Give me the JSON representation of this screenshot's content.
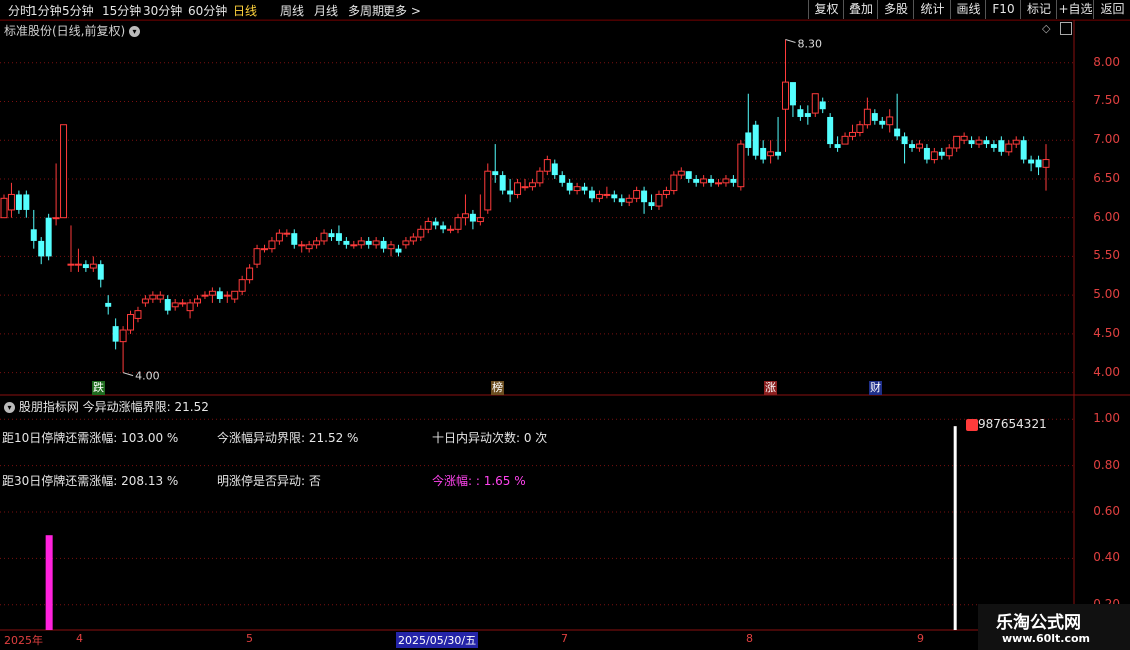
{
  "toolbar": {
    "periods": [
      "分时",
      "1分钟",
      "5分钟",
      "15分钟",
      "30分钟",
      "60分钟",
      "日线",
      "周线",
      "月线",
      "多周期",
      "更多 >"
    ],
    "active_period": "日线",
    "buttons": [
      "复权",
      "叠加",
      "多股",
      "统计",
      "画线",
      "F10",
      "标记",
      "+自选",
      "返回"
    ]
  },
  "main_chart": {
    "title": "标准股份(日线,前复权)",
    "y_labels": [
      "8.00",
      "7.50",
      "7.00",
      "6.50",
      "6.00",
      "5.50",
      "5.00",
      "4.50",
      "4.00"
    ],
    "high_label": "8.30",
    "low_label": "4.00",
    "event_tags": [
      "跌",
      "榜",
      "涨",
      "财"
    ]
  },
  "indicator": {
    "title": "股朋指标网",
    "threshold_label": "今异动涨幅界限: 21.52",
    "rows": [
      [
        "距10日停牌还需涨幅: 103.00 %",
        "今涨幅异动界限: 21.52 %",
        "十日内异动次数: 0 次"
      ],
      [
        "距30日停牌还需涨幅: 208.13 %",
        "明涨停是否异动: 否",
        "今涨幅: : 1.65 %"
      ]
    ],
    "y_labels": [
      "1.00",
      "0.80",
      "0.60",
      "0.40",
      "0.20"
    ],
    "marker_text": "987654321"
  },
  "date_axis": {
    "labels": [
      "2025年",
      "4",
      "5",
      "2025/05/30/五",
      "7",
      "8",
      "9"
    ]
  },
  "watermark": {
    "title": "乐淘公式网",
    "url": "www.60lt.com"
  },
  "colors": {
    "up": "#ff3b3b",
    "down": "#54ffff",
    "grid": "#7a1010",
    "magenta": "#ff22dd"
  },
  "chart_data": {
    "type": "candlestick",
    "y_range": [
      3.75,
      8.5
    ],
    "ohlc": [
      [
        6.0,
        6.25,
        6.05,
        6.3
      ],
      [
        6.1,
        6.3,
        6.0,
        6.45
      ],
      [
        6.3,
        6.1,
        6.05,
        6.35
      ],
      [
        6.3,
        6.1,
        6.0,
        6.35
      ],
      [
        5.85,
        5.7,
        5.6,
        6.1
      ],
      [
        5.7,
        5.5,
        5.4,
        5.75
      ],
      [
        6.0,
        5.5,
        5.45,
        6.05
      ],
      [
        6.0,
        6.0,
        5.9,
        6.7
      ],
      [
        6.0,
        7.2,
        6.0,
        7.2
      ],
      [
        5.4,
        5.4,
        5.3,
        5.9
      ],
      [
        5.4,
        5.4,
        5.3,
        5.6
      ],
      [
        5.4,
        5.35,
        5.3,
        5.45
      ],
      [
        5.35,
        5.4,
        5.3,
        5.5
      ],
      [
        5.4,
        5.2,
        5.1,
        5.45
      ],
      [
        4.9,
        4.85,
        4.75,
        5.0
      ],
      [
        4.6,
        4.4,
        4.3,
        4.7
      ],
      [
        4.4,
        4.55,
        4.0,
        4.6
      ],
      [
        4.55,
        4.75,
        4.5,
        4.8
      ],
      [
        4.7,
        4.8,
        4.65,
        4.85
      ],
      [
        4.9,
        4.95,
        4.85,
        5.0
      ],
      [
        4.95,
        5.0,
        4.9,
        5.05
      ],
      [
        4.95,
        5.0,
        4.9,
        5.05
      ],
      [
        4.95,
        4.8,
        4.75,
        5.0
      ],
      [
        4.85,
        4.9,
        4.8,
        4.95
      ],
      [
        4.9,
        4.9,
        4.85,
        4.95
      ],
      [
        4.8,
        4.9,
        4.7,
        4.95
      ],
      [
        4.9,
        4.95,
        4.85,
        5.0
      ],
      [
        5.0,
        5.0,
        4.95,
        5.05
      ],
      [
        5.0,
        5.05,
        4.9,
        5.1
      ],
      [
        5.05,
        4.95,
        4.9,
        5.1
      ],
      [
        5.0,
        5.0,
        4.9,
        5.05
      ],
      [
        4.95,
        5.05,
        4.9,
        5.05
      ],
      [
        5.05,
        5.2,
        5.0,
        5.25
      ],
      [
        5.2,
        5.35,
        5.15,
        5.4
      ],
      [
        5.4,
        5.6,
        5.35,
        5.65
      ],
      [
        5.6,
        5.6,
        5.55,
        5.65
      ],
      [
        5.6,
        5.7,
        5.55,
        5.75
      ],
      [
        5.7,
        5.8,
        5.65,
        5.85
      ],
      [
        5.8,
        5.8,
        5.75,
        5.85
      ],
      [
        5.8,
        5.65,
        5.6,
        5.85
      ],
      [
        5.65,
        5.65,
        5.55,
        5.7
      ],
      [
        5.6,
        5.65,
        5.55,
        5.7
      ],
      [
        5.65,
        5.7,
        5.6,
        5.75
      ],
      [
        5.7,
        5.8,
        5.65,
        5.85
      ],
      [
        5.8,
        5.75,
        5.7,
        5.85
      ],
      [
        5.8,
        5.7,
        5.65,
        5.9
      ],
      [
        5.7,
        5.65,
        5.6,
        5.75
      ],
      [
        5.65,
        5.65,
        5.6,
        5.7
      ],
      [
        5.65,
        5.7,
        5.6,
        5.75
      ],
      [
        5.7,
        5.65,
        5.6,
        5.75
      ],
      [
        5.65,
        5.7,
        5.6,
        5.75
      ],
      [
        5.7,
        5.6,
        5.55,
        5.75
      ],
      [
        5.6,
        5.65,
        5.5,
        5.7
      ],
      [
        5.6,
        5.55,
        5.5,
        5.65
      ],
      [
        5.65,
        5.7,
        5.6,
        5.75
      ],
      [
        5.7,
        5.75,
        5.65,
        5.8
      ],
      [
        5.75,
        5.85,
        5.7,
        5.9
      ],
      [
        5.85,
        5.95,
        5.8,
        6.0
      ],
      [
        5.95,
        5.9,
        5.85,
        6.0
      ],
      [
        5.9,
        5.85,
        5.8,
        5.95
      ],
      [
        5.85,
        5.85,
        5.8,
        5.9
      ],
      [
        5.85,
        6.0,
        5.8,
        6.05
      ],
      [
        6.0,
        6.05,
        5.9,
        6.3
      ],
      [
        6.05,
        5.95,
        5.85,
        6.1
      ],
      [
        5.95,
        6.0,
        5.9,
        6.3
      ],
      [
        6.1,
        6.6,
        6.05,
        6.7
      ],
      [
        6.6,
        6.55,
        6.45,
        6.95
      ],
      [
        6.55,
        6.35,
        6.3,
        6.6
      ],
      [
        6.35,
        6.3,
        6.2,
        6.5
      ],
      [
        6.3,
        6.45,
        6.25,
        6.5
      ],
      [
        6.4,
        6.4,
        6.35,
        6.5
      ],
      [
        6.4,
        6.45,
        6.35,
        6.5
      ],
      [
        6.45,
        6.6,
        6.4,
        6.65
      ],
      [
        6.6,
        6.75,
        6.55,
        6.8
      ],
      [
        6.7,
        6.55,
        6.5,
        6.75
      ],
      [
        6.55,
        6.45,
        6.4,
        6.6
      ],
      [
        6.45,
        6.35,
        6.3,
        6.5
      ],
      [
        6.35,
        6.4,
        6.3,
        6.45
      ],
      [
        6.4,
        6.35,
        6.3,
        6.45
      ],
      [
        6.35,
        6.25,
        6.2,
        6.4
      ],
      [
        6.25,
        6.3,
        6.2,
        6.35
      ],
      [
        6.3,
        6.3,
        6.25,
        6.4
      ],
      [
        6.3,
        6.25,
        6.2,
        6.35
      ],
      [
        6.25,
        6.2,
        6.15,
        6.3
      ],
      [
        6.2,
        6.25,
        6.15,
        6.3
      ],
      [
        6.25,
        6.35,
        6.2,
        6.4
      ],
      [
        6.35,
        6.2,
        6.05,
        6.4
      ],
      [
        6.2,
        6.15,
        6.1,
        6.3
      ],
      [
        6.15,
        6.3,
        6.1,
        6.35
      ],
      [
        6.3,
        6.35,
        6.25,
        6.4
      ],
      [
        6.35,
        6.55,
        6.3,
        6.6
      ],
      [
        6.55,
        6.6,
        6.5,
        6.65
      ],
      [
        6.6,
        6.5,
        6.45,
        6.6
      ],
      [
        6.5,
        6.45,
        6.4,
        6.55
      ],
      [
        6.45,
        6.5,
        6.4,
        6.55
      ],
      [
        6.5,
        6.45,
        6.4,
        6.55
      ],
      [
        6.45,
        6.45,
        6.4,
        6.5
      ],
      [
        6.45,
        6.5,
        6.4,
        6.55
      ],
      [
        6.5,
        6.45,
        6.4,
        6.55
      ],
      [
        6.4,
        6.95,
        6.35,
        7.0
      ],
      [
        7.1,
        6.9,
        6.8,
        7.6
      ],
      [
        7.2,
        6.8,
        6.75,
        7.25
      ],
      [
        6.9,
        6.75,
        6.7,
        7.0
      ],
      [
        6.8,
        6.85,
        6.7,
        7.0
      ],
      [
        6.85,
        6.8,
        6.75,
        7.3
      ],
      [
        7.4,
        7.75,
        6.85,
        8.3
      ],
      [
        7.75,
        7.45,
        7.3,
        7.5
      ],
      [
        7.4,
        7.3,
        7.25,
        7.45
      ],
      [
        7.35,
        7.3,
        7.2,
        7.45
      ],
      [
        7.35,
        7.6,
        7.3,
        7.6
      ],
      [
        7.5,
        7.4,
        7.35,
        7.55
      ],
      [
        7.3,
        6.95,
        6.9,
        7.35
      ],
      [
        6.95,
        6.9,
        6.85,
        7.05
      ],
      [
        6.95,
        7.05,
        6.95,
        7.1
      ],
      [
        7.05,
        7.1,
        7.0,
        7.2
      ],
      [
        7.1,
        7.2,
        7.05,
        7.25
      ],
      [
        7.2,
        7.4,
        7.15,
        7.55
      ],
      [
        7.35,
        7.25,
        7.2,
        7.4
      ],
      [
        7.25,
        7.2,
        7.15,
        7.3
      ],
      [
        7.2,
        7.3,
        7.1,
        7.4
      ],
      [
        7.15,
        7.05,
        7.0,
        7.6
      ],
      [
        7.05,
        6.95,
        6.7,
        7.1
      ],
      [
        6.95,
        6.9,
        6.85,
        7.0
      ],
      [
        6.9,
        6.95,
        6.85,
        7.0
      ],
      [
        6.9,
        6.75,
        6.7,
        6.95
      ],
      [
        6.75,
        6.85,
        6.7,
        6.9
      ],
      [
        6.85,
        6.8,
        6.75,
        6.9
      ],
      [
        6.8,
        6.9,
        6.75,
        6.95
      ],
      [
        6.9,
        7.05,
        6.85,
        7.05
      ],
      [
        7.0,
        7.05,
        6.95,
        7.1
      ],
      [
        7.0,
        6.95,
        6.9,
        7.05
      ],
      [
        6.95,
        7.0,
        6.9,
        7.05
      ],
      [
        7.0,
        6.95,
        6.9,
        7.05
      ],
      [
        6.95,
        6.9,
        6.85,
        7.0
      ],
      [
        7.0,
        6.85,
        6.8,
        7.05
      ],
      [
        6.85,
        6.95,
        6.8,
        7.0
      ],
      [
        6.95,
        7.0,
        6.9,
        7.05
      ],
      [
        7.0,
        6.75,
        6.7,
        7.05
      ],
      [
        6.75,
        6.7,
        6.6,
        6.8
      ],
      [
        6.75,
        6.65,
        6.55,
        6.8
      ],
      [
        6.65,
        6.75,
        6.35,
        6.95
      ]
    ],
    "indicator_range": [
      0.1,
      1.1
    ],
    "indicator_bars": [
      {
        "index": 6,
        "value": 0.5,
        "color": "magenta"
      },
      {
        "index": 128,
        "value": 0.97,
        "color": "white"
      }
    ]
  }
}
